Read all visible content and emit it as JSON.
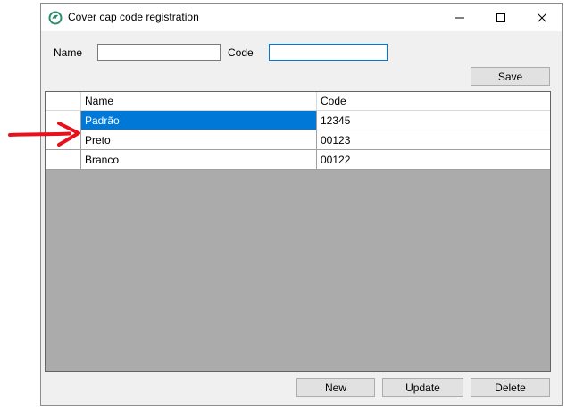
{
  "window": {
    "title": "Cover cap code registration",
    "minimize_glyph": "—",
    "maximize_glyph": "☐",
    "close_glyph": "✕"
  },
  "form": {
    "name_label": "Name",
    "name_value": "",
    "code_label": "Code",
    "code_value": "",
    "save_label": "Save"
  },
  "grid": {
    "columns": [
      "Name",
      "Code"
    ],
    "rows": [
      {
        "name": "Padrão",
        "code": "12345",
        "selected": true
      },
      {
        "name": "Preto",
        "code": "00123",
        "selected": false
      },
      {
        "name": "Branco",
        "code": "00122",
        "selected": false
      }
    ]
  },
  "actions": {
    "new_label": "New",
    "update_label": "Update",
    "delete_label": "Delete"
  },
  "colors": {
    "selection": "#0078d7",
    "grid_background": "#ababab",
    "annotation_arrow": "#e8101a",
    "app_icon": "#2a8c6e"
  },
  "icons": {
    "app": "app-icon",
    "annotation": "red-arrow-icon"
  }
}
